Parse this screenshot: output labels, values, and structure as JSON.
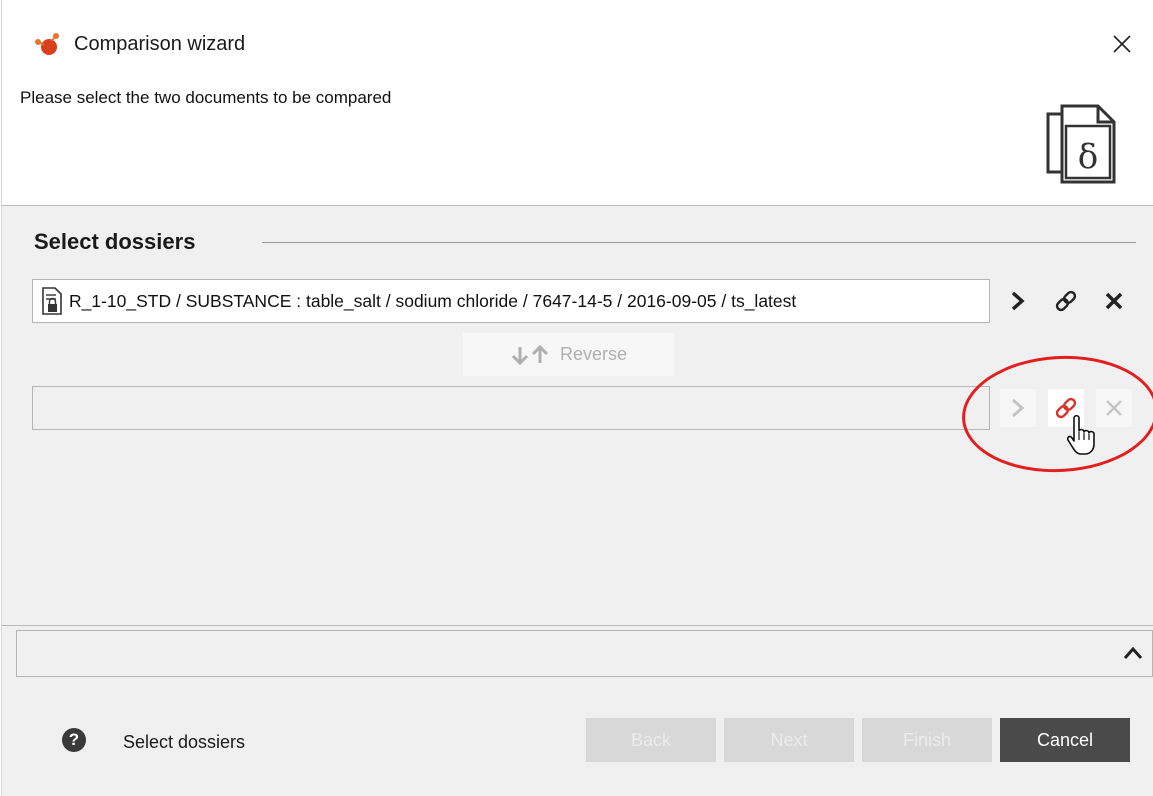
{
  "window": {
    "title": "Comparison wizard",
    "icon": "app-molecule-icon",
    "close_icon": "close-icon"
  },
  "header": {
    "instruction": "Please select the two documents to be compared",
    "icon": "compare-documents-delta-icon"
  },
  "section": {
    "title": "Select dossiers"
  },
  "first_document": {
    "icon": "locked-document-icon",
    "text": "R_1-10_STD / SUBSTANCE : table_salt / sodium chloride / 7647-14-5 /  2016-09-05 / ts_latest"
  },
  "reverse_button": {
    "label": "Reverse",
    "enabled": false
  },
  "second_document": {
    "text": ""
  },
  "row_actions": {
    "open_icon": "chevron-right-icon",
    "link_icon": "link-icon",
    "remove_icon": "close-icon"
  },
  "footer": {
    "help_glyph": "?",
    "step_label": "Select dossiers",
    "buttons": {
      "back": "Back",
      "next": "Next",
      "finish": "Finish",
      "cancel": "Cancel"
    }
  },
  "colors": {
    "annotation": "#e41e1e",
    "link_active": "#d9322a",
    "cancel_bg": "#4a4a4a",
    "disabled_bg": "#d8d8d8"
  }
}
